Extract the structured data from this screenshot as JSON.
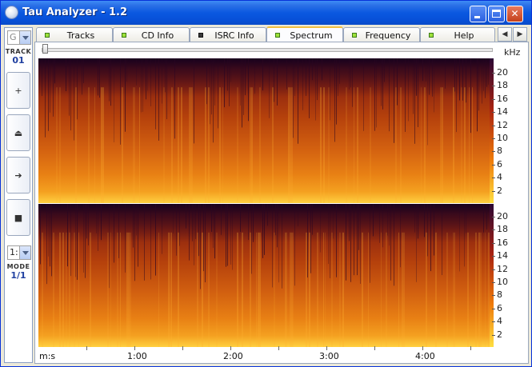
{
  "window": {
    "title": "Tau Analyzer - 1.2"
  },
  "left": {
    "generation_value": "G",
    "track_label": "TRACK",
    "track_value": "01",
    "mode_select_value": "1:",
    "mode_label": "MODE",
    "mode_value": "1/1",
    "buttons": [
      {
        "name": "add-button",
        "glyph": "+"
      },
      {
        "name": "eject-button",
        "glyph": "⏏"
      },
      {
        "name": "play-button",
        "glyph": "➔"
      },
      {
        "name": "stop-button",
        "glyph": "■"
      }
    ]
  },
  "tabs": [
    {
      "label": "Tracks",
      "led": "green"
    },
    {
      "label": "CD Info",
      "led": "green"
    },
    {
      "label": "ISRC Info",
      "led": "dark"
    },
    {
      "label": "Spectrum",
      "led": "green",
      "active": true
    },
    {
      "label": "Frequency",
      "led": "green"
    },
    {
      "label": "Help",
      "led": "green"
    }
  ],
  "tab_arrows": {
    "left": "◀",
    "right": "▶"
  },
  "spectrum": {
    "y_unit": "kHz",
    "y_ticks": [
      "20",
      "18",
      "16",
      "14",
      "12",
      "10",
      "8",
      "6",
      "4",
      "2"
    ],
    "x_unit": "m:s",
    "x_labels": [
      "1:00",
      "2:00",
      "3:00",
      "4:00"
    ],
    "slider_position": 0
  },
  "colors": {
    "title_bar": "#0a58e0",
    "spectrum_dark": "#1e0a2c",
    "spectrum_hot": "#ffd040",
    "accent_led": "#9ee23a"
  }
}
